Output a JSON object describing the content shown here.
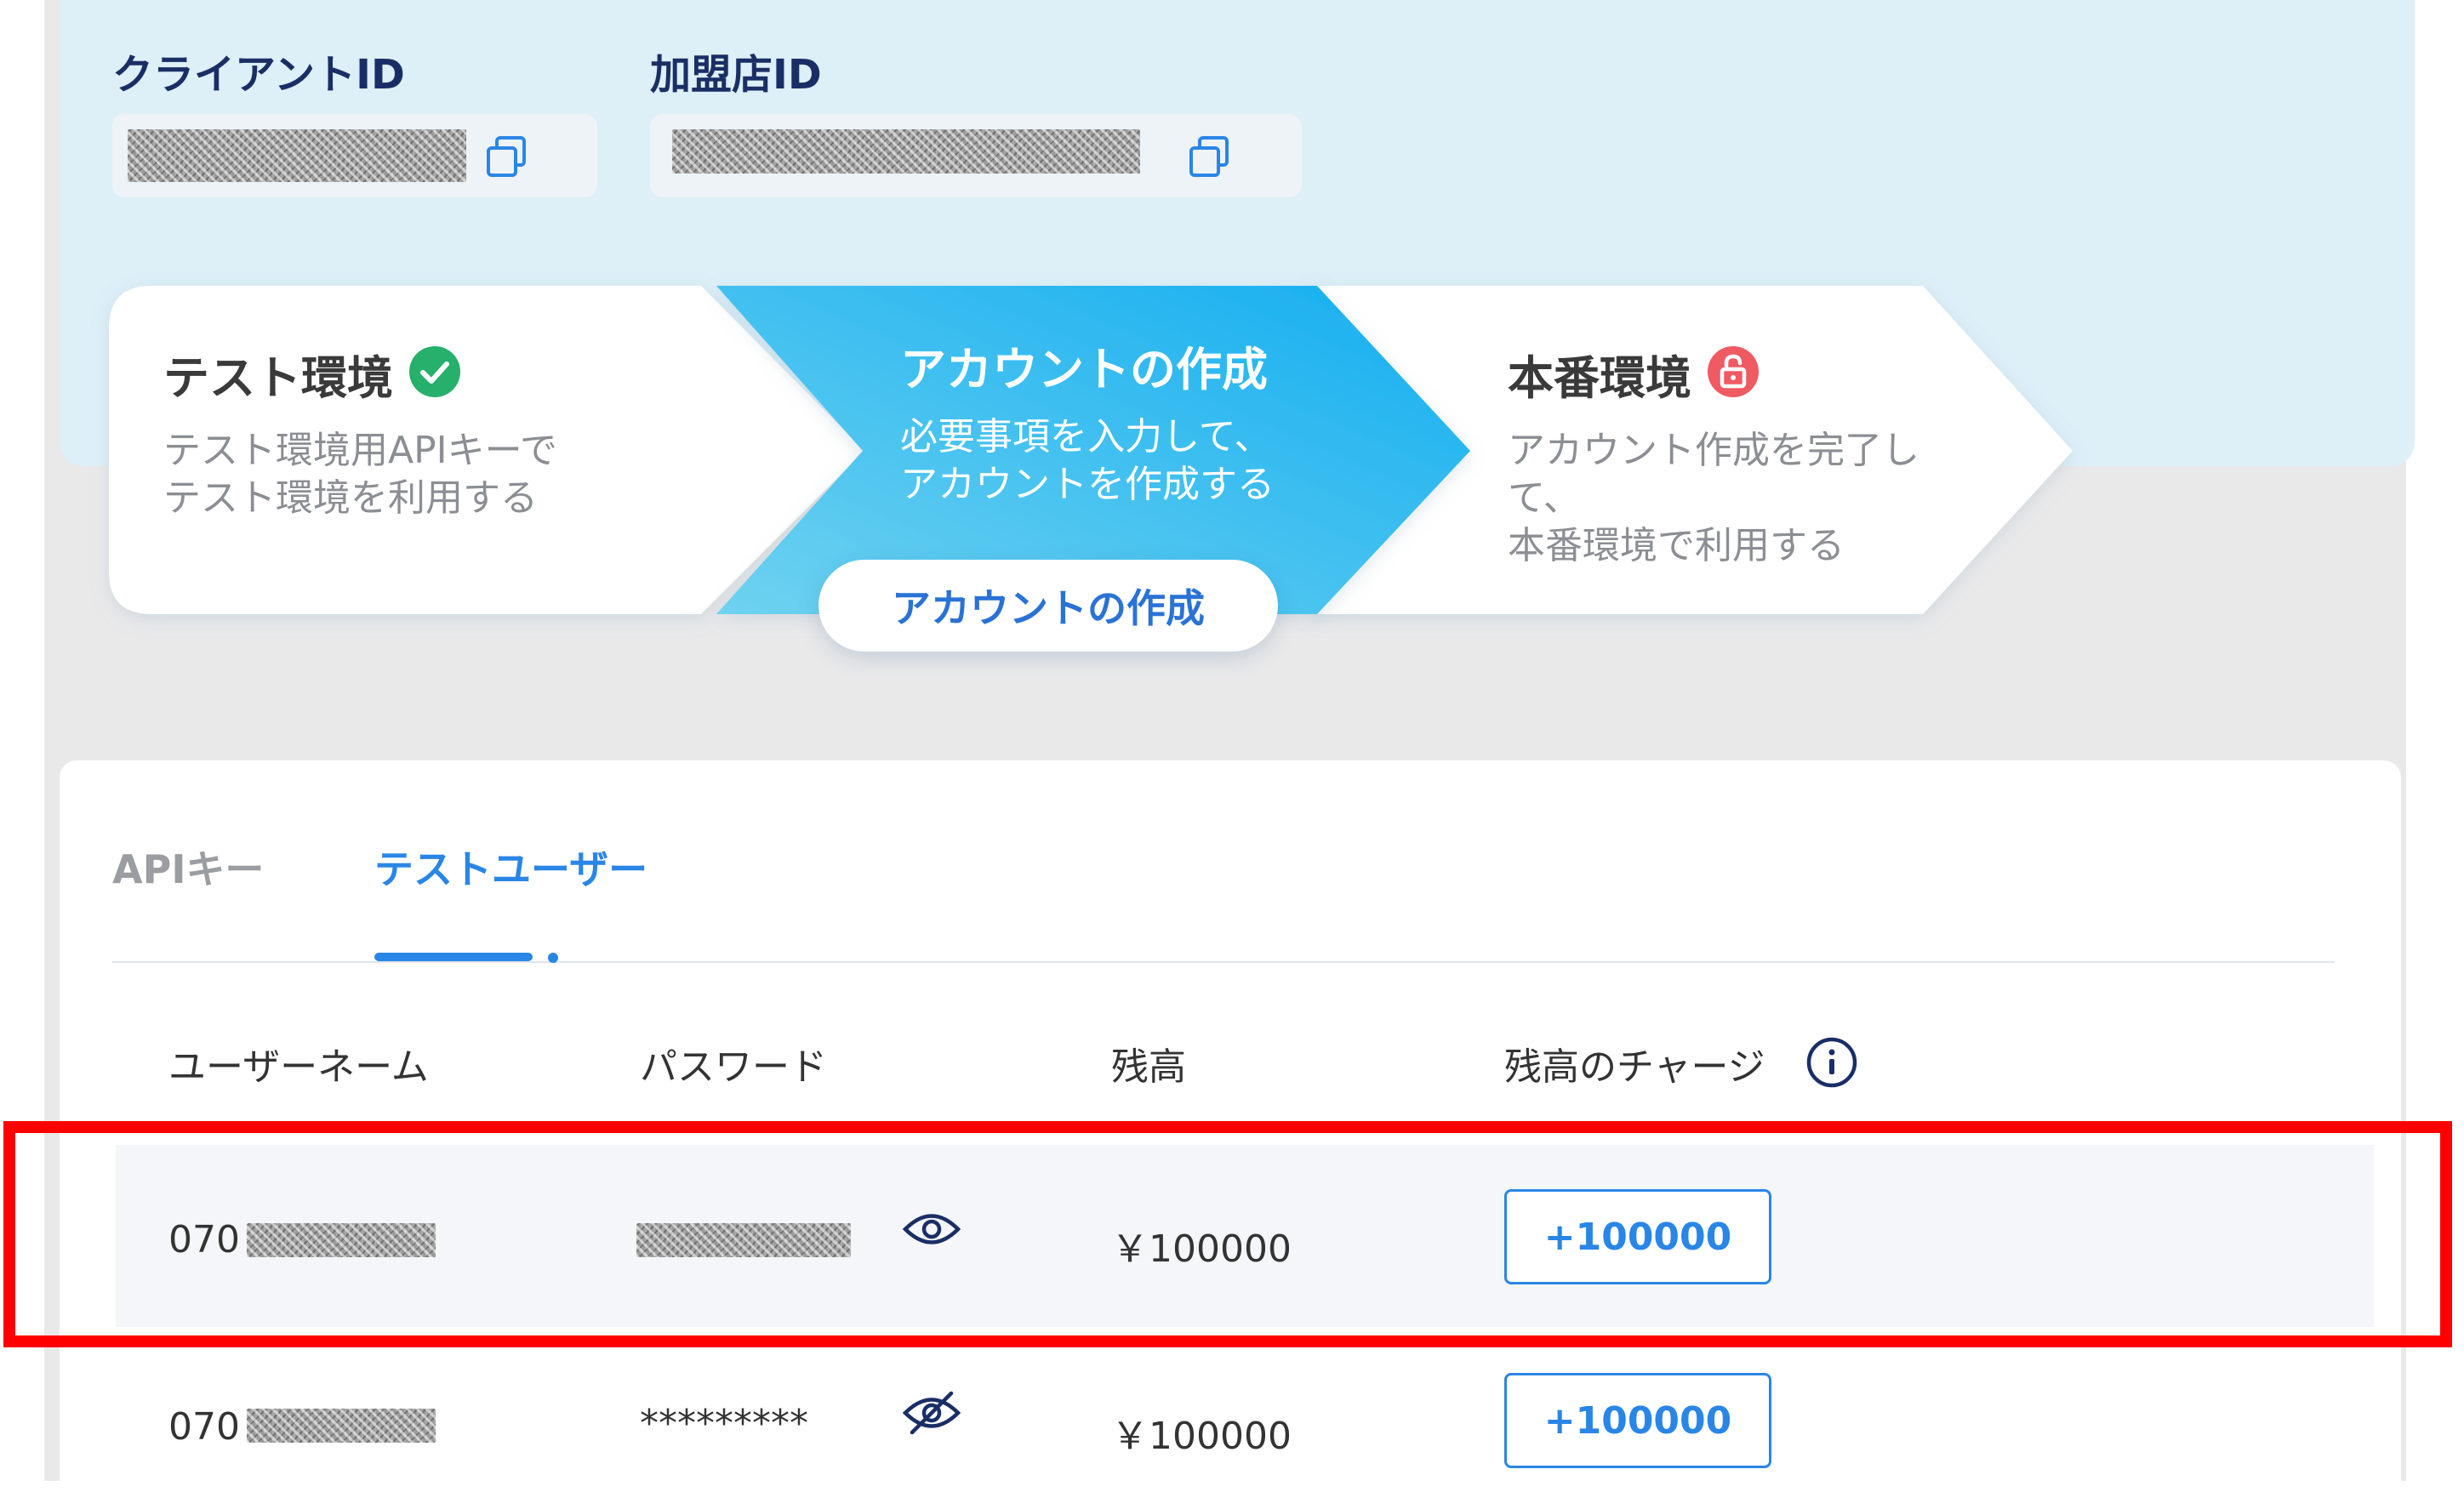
{
  "credentials": {
    "client_id_label": "クライアントID",
    "merchant_id_label": "加盟店ID"
  },
  "steps": [
    {
      "title": "テスト環境",
      "description": "テスト環境用APIキーで\nテスト環境を利用する",
      "status": "complete"
    },
    {
      "title": "アカウントの作成",
      "description": "必要事項を入力して、\nアカウントを作成する",
      "button_label": "アカウントの作成",
      "status": "active"
    },
    {
      "title": "本番環境",
      "description": "アカウント作成を完了し\nて、\n本番環境で利用する",
      "status": "locked"
    }
  ],
  "tabs": [
    {
      "label": "APIキー",
      "active": false
    },
    {
      "label": "テストユーザー",
      "active": true
    }
  ],
  "table": {
    "headers": [
      "ユーザーネーム",
      "パスワード",
      "残高",
      "残高のチャージ"
    ],
    "rows": [
      {
        "username_prefix": "070",
        "password": "",
        "password_visible": true,
        "balance": "￥100000",
        "charge_label": "+100000",
        "highlighted": true
      },
      {
        "username_prefix": "070",
        "password": "*********",
        "password_visible": false,
        "balance": "￥100000",
        "charge_label": "+100000",
        "highlighted": false
      }
    ]
  },
  "colors": {
    "accent": "#2a86e6",
    "navy": "#1a2e66",
    "panel": "#ddeff7",
    "active_step_start": "#6fd2f0",
    "active_step_end": "#14aef0",
    "success": "#27b06b",
    "lock": "#ef5a63",
    "highlight": "#ff0000"
  }
}
